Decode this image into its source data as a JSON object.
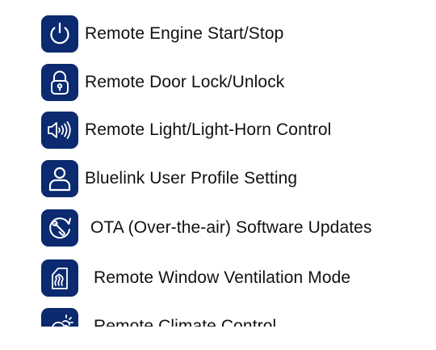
{
  "features": [
    {
      "icon": "power-icon",
      "label": "Remote Engine Start/Stop"
    },
    {
      "icon": "padlock-icon",
      "label": "Remote Door Lock/Unlock"
    },
    {
      "icon": "horn-speaker-icon",
      "label": "Remote Light/Light-Horn Control"
    },
    {
      "icon": "user-profile-icon",
      "label": "Bluelink User Profile Setting"
    },
    {
      "icon": "software-update-icon",
      "label": "OTA (Over-the-air) Software Updates"
    },
    {
      "icon": "window-ventilation-icon",
      "label": "Remote Window Ventilation Mode"
    },
    {
      "icon": "climate-cloud-sun-icon",
      "label": "Remote Climate Control"
    }
  ],
  "colors": {
    "icon_tile": "#0b2a6f",
    "icon_stroke": "#ffffff",
    "text": "#111111"
  }
}
